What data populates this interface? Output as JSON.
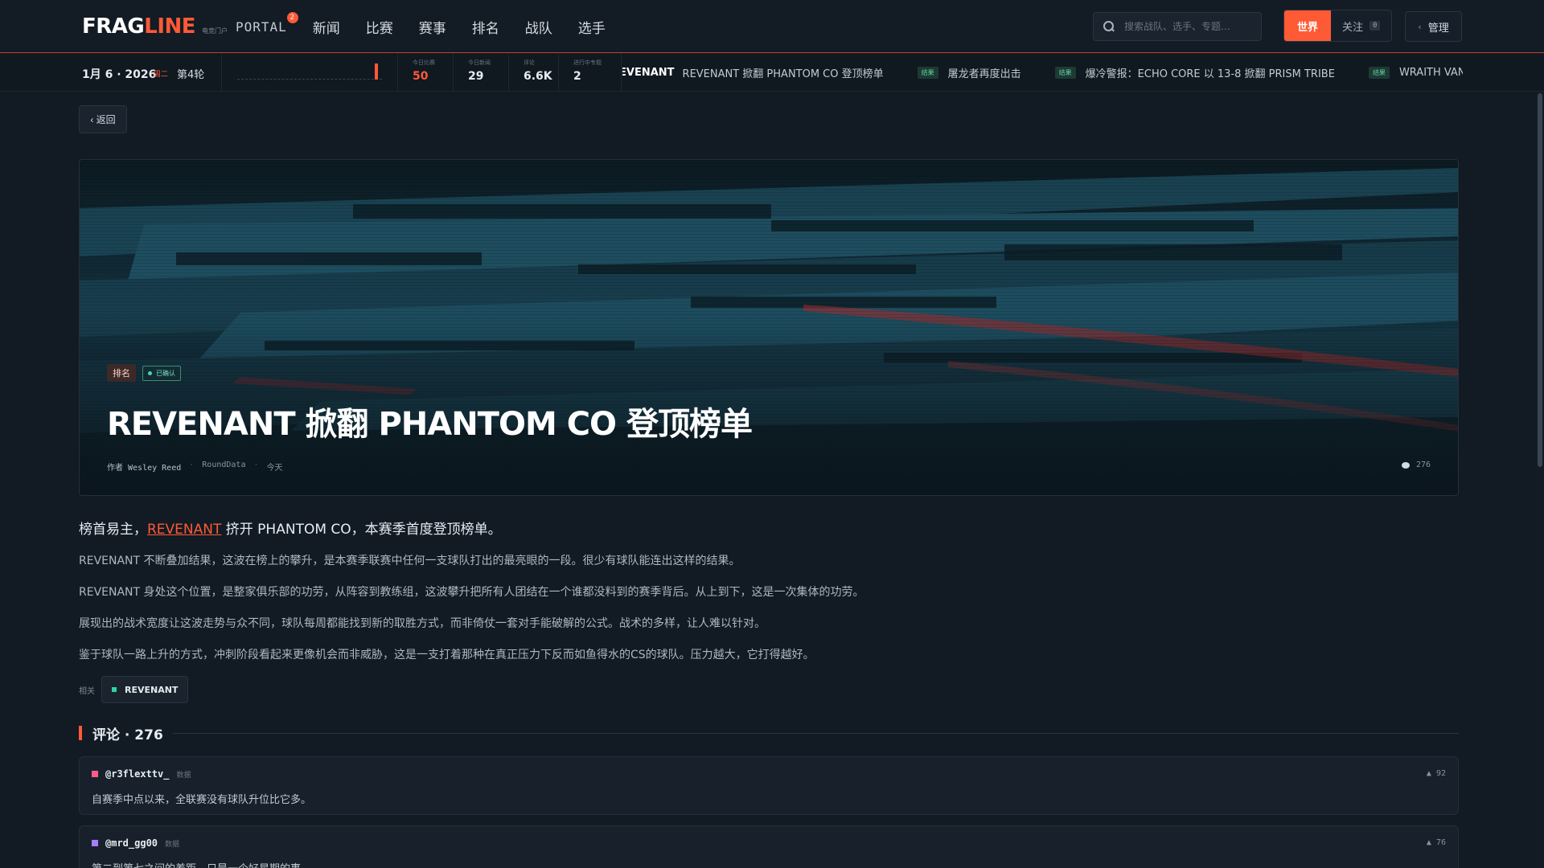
{
  "nav": {
    "logo_a": "FRAG",
    "logo_b": "LINE",
    "logo_sub": "电竞门户",
    "portal": "PORTAL",
    "portal_badge": "2",
    "links": [
      "新闻",
      "比赛",
      "赛事",
      "排名",
      "战队",
      "选手"
    ],
    "search_placeholder": "搜索战队、选手、专题…",
    "scope_active": "世界",
    "scope_follow": "关注",
    "follow_count": "0",
    "admin": "管理"
  },
  "strip": {
    "date": "1月 6 · 2026",
    "weekday": "周二",
    "round": "第4轮",
    "round_progress": 0.97,
    "stats": [
      {
        "label": "今日比赛",
        "value": "50"
      },
      {
        "label": "今日新闻",
        "value": "29"
      },
      {
        "label": "评论",
        "value": "6.6K"
      },
      {
        "label": "进行中专题",
        "value": "2"
      }
    ],
    "ticker": [
      {
        "team": "REVENANT",
        "text": "REVENANT 掀翻 PHANTOM CO 登顶榜单"
      },
      {
        "tag": "结果",
        "text": "屠龙者再度出击"
      },
      {
        "tag": "结果",
        "text": "爆冷警报：ECHO CORE 以 13-8 掀翻 PRISM TRIBE"
      },
      {
        "tag": "结果",
        "text": "WRAITH VANGUARD"
      }
    ]
  },
  "back_label": "‹ 返回",
  "article": {
    "category": "排名",
    "verified": "已确认",
    "title": "REVENANT 掀翻 PHANTOM CO 登顶榜单",
    "author": "作者 Wesley Reed",
    "source": "RoundData",
    "time": "今天",
    "comment_count": "276",
    "lead_before": "榜首易主，",
    "lead_link": "REVENANT",
    "lead_after": " 挤开 PHANTOM CO，本赛季首度登顶榜单。",
    "paragraphs": [
      "REVENANT 不断叠加结果，这波在榜上的攀升，是本赛季联赛中任何一支球队打出的最亮眼的一段。很少有球队能连出这样的结果。",
      "REVENANT 身处这个位置，是整家俱乐部的功劳，从阵容到教练组，这波攀升把所有人团结在一个谁都没料到的赛季背后。从上到下，这是一次集体的功劳。",
      "展现出的战术宽度让这波走势与众不同，球队每周都能找到新的取胜方式，而非倚仗一套对手能破解的公式。战术的多样，让人难以针对。",
      "鉴于球队一路上升的方式，冲刺阶段看起来更像机会而非威胁，这是一支打着那种在真正压力下反而如鱼得水的CS的球队。压力越大，它打得越好。"
    ],
    "related_label": "相关",
    "related_team": "REVENANT",
    "related_color": "#2ed3a0"
  },
  "comments_section": {
    "title": "评论 · 276",
    "items": [
      {
        "user": "@r3flexttv_",
        "role": "数据",
        "votes": "▲ 92",
        "text": "自赛季中点以来，全联赛没有球队升位比它多。",
        "color": "#ff5c8a"
      },
      {
        "user": "@mrd_gg00",
        "role": "数据",
        "votes": "▲ 76",
        "text": "第二到第七之间的差距，只是一个好星期的事。",
        "color": "#a97dff"
      }
    ]
  },
  "colors": {
    "accent": "#ff5a36",
    "success": "#3ee092"
  }
}
